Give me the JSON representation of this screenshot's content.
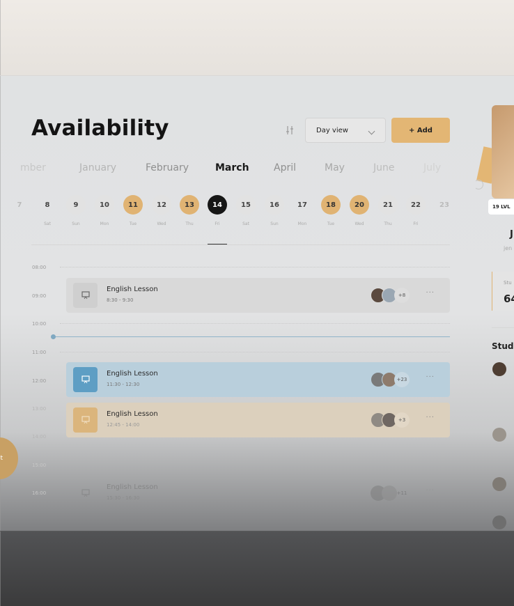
{
  "header": {
    "title": "Availability",
    "view_select": "Day view",
    "add_label": "+ Add",
    "accent_color": "#e3b674"
  },
  "months": [
    "mber",
    "January",
    "February",
    "March",
    "April",
    "May",
    "June",
    "July"
  ],
  "selected_month": "March",
  "dates": [
    {
      "num": "7",
      "dow": ""
    },
    {
      "num": "8",
      "dow": "Sat"
    },
    {
      "num": "9",
      "dow": "Sun"
    },
    {
      "num": "10",
      "dow": "Mon"
    },
    {
      "num": "11",
      "dow": "Tue"
    },
    {
      "num": "12",
      "dow": "Wed"
    },
    {
      "num": "13",
      "dow": "Thu"
    },
    {
      "num": "14",
      "dow": "Fri"
    },
    {
      "num": "15",
      "dow": "Sat"
    },
    {
      "num": "16",
      "dow": "Sun"
    },
    {
      "num": "17",
      "dow": "Mon"
    },
    {
      "num": "18",
      "dow": "Tue"
    },
    {
      "num": "20",
      "dow": "Wed"
    },
    {
      "num": "21",
      "dow": "Thu"
    },
    {
      "num": "22",
      "dow": "Fri"
    },
    {
      "num": "23",
      "dow": ""
    }
  ],
  "selected_date": "14",
  "highlighted_dates": [
    "11",
    "13",
    "18",
    "20"
  ],
  "times": [
    "08:00",
    "09:00",
    "10:00",
    "11:00",
    "12:00",
    "13:00",
    "14:00",
    "15:00",
    "16:00"
  ],
  "lessons": [
    {
      "name": "English Lesson",
      "time": "8:30 - 9:30",
      "extra": "+8"
    },
    {
      "name": "English Lesson",
      "time": "11:30 - 12:30",
      "extra": "+23"
    },
    {
      "name": "English Lesson",
      "time": "12:45 - 14:00",
      "extra": "+3"
    },
    {
      "name": "English Lesson",
      "time": "15:30 - 16:30",
      "extra": "+11"
    }
  ],
  "fab_label": "t",
  "profile": {
    "level": "19 LVL",
    "name_fragment": "J",
    "email_fragment": "jen",
    "stat_label_fragment": "Stu",
    "stat_value_fragment": "64",
    "students_heading_fragment": "Stude"
  }
}
